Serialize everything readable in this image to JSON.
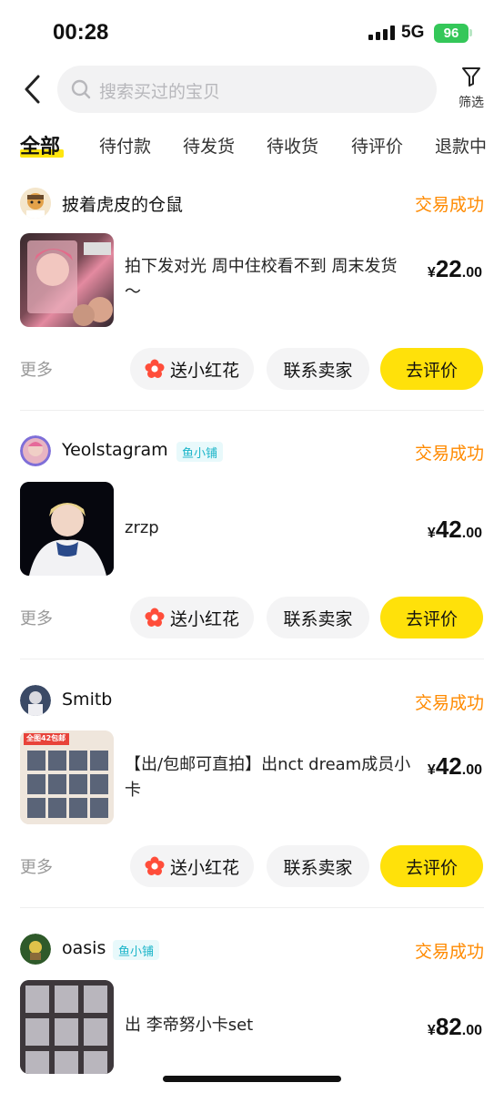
{
  "status_bar": {
    "time": "00:28",
    "network": "5G",
    "battery": "96"
  },
  "search": {
    "placeholder": "搜索买过的宝贝"
  },
  "filter": {
    "label": "筛选",
    "icon": "funnel-icon"
  },
  "tabs": [
    "全部",
    "待付款",
    "待发货",
    "待收货",
    "待评价",
    "退款中"
  ],
  "active_tab": "全部",
  "colors": {
    "accent_yellow": "#ffe10a",
    "status_orange": "#ff8a00",
    "badge_cyan": "#1bb5c9"
  },
  "orders": [
    {
      "seller": "披着虎皮的仓鼠",
      "badge": "",
      "status": "交易成功",
      "title": "拍下发对光 周中住校看不到 周末发货～",
      "price_currency": "¥",
      "price_int": "22",
      "price_dec": ".00",
      "more": "更多",
      "btn_flower": "送小红花",
      "btn_contact": "联系卖家",
      "btn_review": "去评价"
    },
    {
      "seller": "Yeolstagram",
      "badge": "鱼小铺",
      "status": "交易成功",
      "title": "zrzp",
      "price_currency": "¥",
      "price_int": "42",
      "price_dec": ".00",
      "more": "更多",
      "btn_flower": "送小红花",
      "btn_contact": "联系卖家",
      "btn_review": "去评价"
    },
    {
      "seller": "Smitb",
      "badge": "",
      "status": "交易成功",
      "title": "【出/包邮可直拍】出nct dream成员小卡",
      "price_currency": "¥",
      "price_int": "42",
      "price_dec": ".00",
      "more": "更多",
      "btn_flower": "送小红花",
      "btn_contact": "联系卖家",
      "btn_review": "去评价",
      "thumb_label": "全图42包邮"
    },
    {
      "seller": "oasis",
      "badge": "鱼小铺",
      "status": "交易成功",
      "title": "出 李帝努小卡set",
      "price_currency": "¥",
      "price_int": "82",
      "price_dec": ".00"
    }
  ]
}
